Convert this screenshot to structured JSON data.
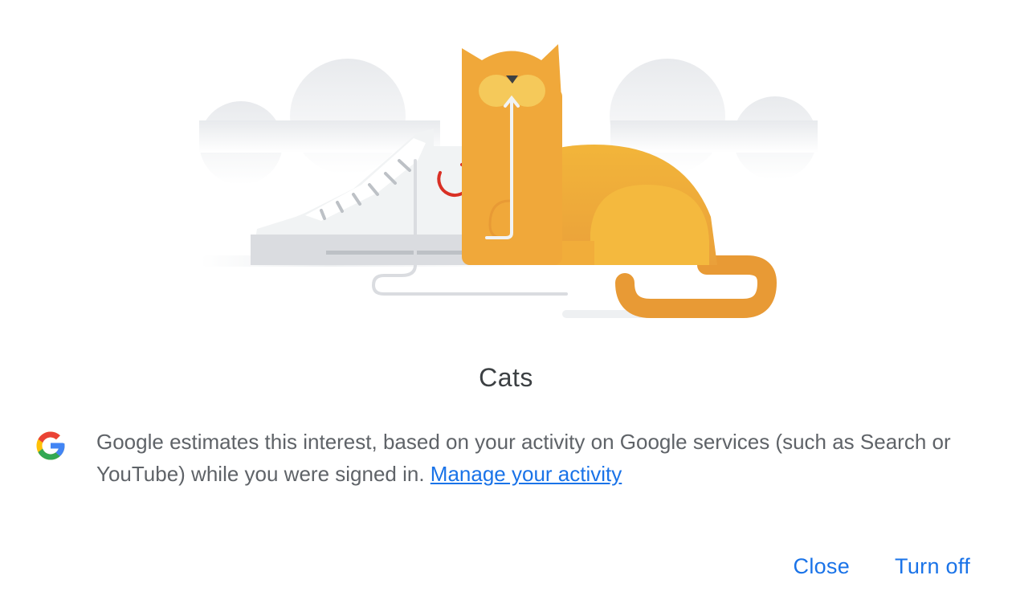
{
  "dialog": {
    "title": "Cats",
    "description": "Google estimates this interest, based on your activity on Google services (such as Search or YouTube) while you were signed in.",
    "manage_link": "Manage your activity",
    "close_label": "Close",
    "turn_off_label": "Turn off"
  },
  "icons": {
    "logo": "google-g-icon",
    "illustration": "cat-and-sneaker-illustration"
  },
  "colors": {
    "accent": "#1a73e8",
    "title": "#3c4043",
    "text": "#5f6368",
    "cat": "#f0a83a",
    "shoe_logo": "#d93025"
  }
}
